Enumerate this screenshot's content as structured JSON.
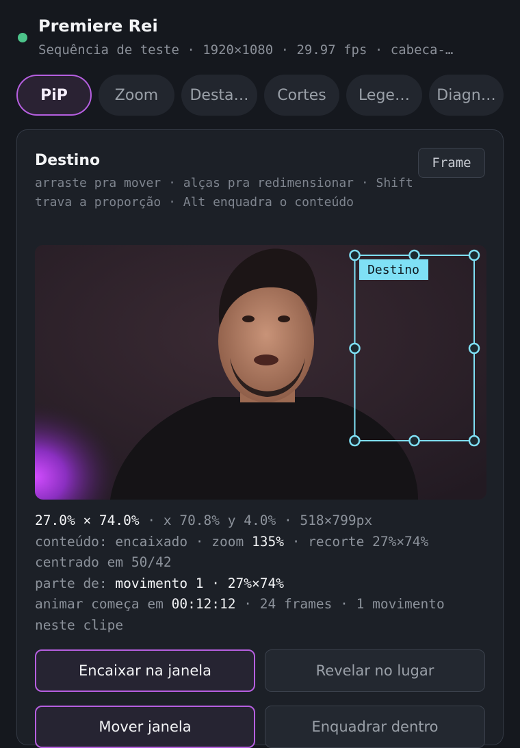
{
  "header": {
    "title": "Premiere Rei",
    "subtitle": "Sequência de teste · 1920×1080 · 29.97 fps · cabeca-…",
    "status_color": "#4cc38a"
  },
  "tabs": [
    {
      "label": "PiP",
      "active": true
    },
    {
      "label": "Zoom",
      "active": false
    },
    {
      "label": "Desta…",
      "active": false
    },
    {
      "label": "Cortes",
      "active": false
    },
    {
      "label": "Lege…",
      "active": false
    },
    {
      "label": "Diagn…",
      "active": false
    }
  ],
  "panel": {
    "title": "Destino",
    "frame_button": "Frame",
    "hint": "arraste pra mover · alças pra redimensionar · Shift trava a proporção · Alt enquadra o conteúdo",
    "preview": {
      "box_label": "Destino",
      "box_color": "#7fe0f5"
    },
    "info": {
      "line1_size": "27.0% × 74.0%",
      "line1_rest": " · x 70.8% y 4.0% · 518×799px",
      "line2_prefix": "conteúdo: encaixado · zoom ",
      "line2_zoom": "135%",
      "line2_rest": " · recorte 27%×74% centrado em 50/42",
      "line3_prefix": "parte de: ",
      "line3_value": "movimento 1 · 27%×74%",
      "line4_prefix": "animar começa em ",
      "line4_time": "00:12:12",
      "line4_rest": " · 24 frames · 1 movimento neste clipe"
    },
    "buttons": {
      "fit_window": "Encaixar na janela",
      "reveal_in_place": "Revelar no lugar",
      "move_window": "Mover janela",
      "frame_inside": "Enquadrar dentro"
    }
  }
}
